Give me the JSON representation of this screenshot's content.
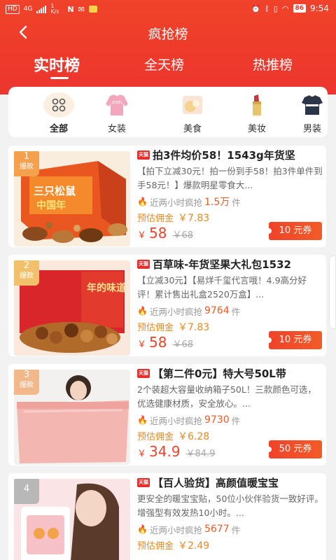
{
  "status_bar": {
    "carrier_hd": "HD",
    "net": "4G",
    "speed": "1 K/s",
    "battery": "86",
    "time": "9:54"
  },
  "nav": {
    "title": "疯抢榜"
  },
  "tabs": [
    {
      "label": "实时榜",
      "active": true
    },
    {
      "label": "全天榜",
      "active": false
    },
    {
      "label": "热推榜",
      "active": false
    }
  ],
  "categories": [
    {
      "label": "全部",
      "icon": "grid-icon",
      "active": true
    },
    {
      "label": "女装",
      "icon": "sweater-icon",
      "active": false
    },
    {
      "label": "美食",
      "icon": "food-icon",
      "active": false
    },
    {
      "label": "美妆",
      "icon": "lipstick-icon",
      "active": false
    },
    {
      "label": "男装",
      "icon": "shirt-icon",
      "active": false
    }
  ],
  "products": [
    {
      "rank": "1",
      "rank_tag": "爆款",
      "title": "拍3件均价58！1543g年货坚",
      "desc": "【拍下立减30元！拍一份到手58！拍3件单件到手58元！】爆款明星零食大...",
      "sold_label": "近两小时疯抢",
      "sold_num": "1.5万",
      "sold_unit": "件",
      "comm_label": "预估佣金",
      "comm_value": "￥7.83",
      "price_symbol": "￥",
      "price": "58",
      "old_price": "￥68",
      "coupon": "10 元券"
    },
    {
      "rank": "2",
      "rank_tag": "爆款",
      "title": "百草味-年货坚果大礼包1532",
      "desc": "【立减30元】【易烊千玺代言哦！4.9高分好评！累计售出礼盒2520万盒】...",
      "sold_label": "近两小时疯抢",
      "sold_num": "9764",
      "sold_unit": "件",
      "comm_label": "预估佣金",
      "comm_value": "￥7.83",
      "price_symbol": "￥",
      "price": "58",
      "old_price": "￥68",
      "coupon": "10 元券"
    },
    {
      "rank": "3",
      "rank_tag": "爆款",
      "title": "【第二件0元】特大号50L带",
      "desc": "2个装超大容量收纳箱子50L！三款颜色可选，优选健康材质，安全放心。...",
      "sold_label": "近两小时疯抢",
      "sold_num": "9730",
      "sold_unit": "件",
      "comm_label": "预估佣金",
      "comm_value": "￥6.28",
      "price_symbol": "￥",
      "price": "34.9",
      "old_price": "￥84.9",
      "coupon": "50 元券"
    },
    {
      "rank": "4",
      "rank_tag": "",
      "title": "【百人验货】高颜值暖宝宝",
      "desc": "更安全的暖宝宝贴，50位小伙伴验货一致好评。增强型有效发热10小时。...",
      "sold_label": "近两小时疯抢",
      "sold_num": "5677",
      "sold_unit": "件",
      "comm_label": "预估佣金",
      "comm_value": "￥2.49",
      "price_symbol": "",
      "price": "",
      "old_price": "",
      "coupon": ""
    }
  ],
  "thumb_texts": {
    "p1_box": "三只松鼠",
    "p1_box2": "中国年",
    "p2_box": "年的味道"
  },
  "colors": {
    "header_red": "#ee3a2b",
    "price_red": "#f0432a",
    "commission_orange": "#e8891f",
    "rank_badge": "#f5a04d"
  }
}
